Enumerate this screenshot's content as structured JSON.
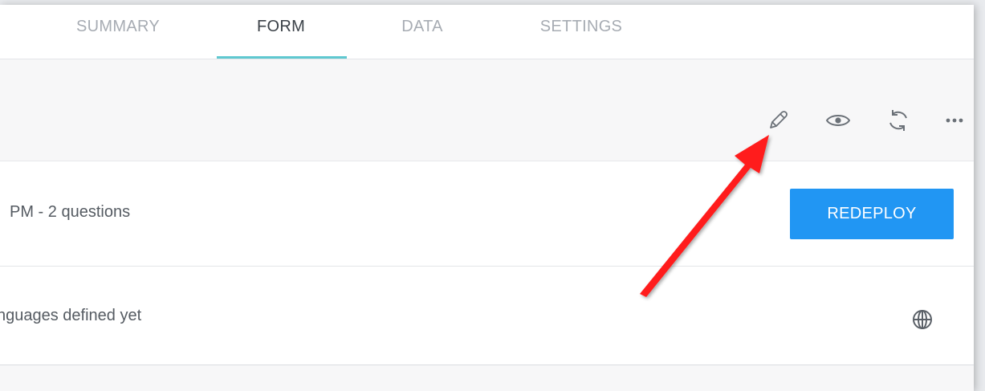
{
  "tabs": [
    {
      "label": "SUMMARY",
      "active": false
    },
    {
      "label": "FORM",
      "active": true
    },
    {
      "label": "DATA",
      "active": false
    },
    {
      "label": "SETTINGS",
      "active": false
    }
  ],
  "toolbar": {
    "icons": [
      "pencil-icon",
      "eye-icon",
      "refresh-icon",
      "more-icon"
    ]
  },
  "deployment": {
    "info": "PM - 2 questions",
    "button_label": "REDEPLOY"
  },
  "languages": {
    "text": "nguages defined yet",
    "icon": "globe-icon"
  },
  "colors": {
    "accent": "#2196f3",
    "tab_underline": "#5fc8d0",
    "annotation_arrow": "#ff1a1a"
  }
}
